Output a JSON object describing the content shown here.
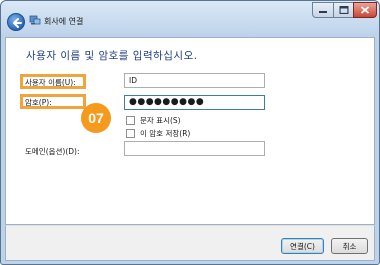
{
  "window": {
    "title": "회사에 연결",
    "controls": {
      "minimize_icon": "minimize-icon",
      "maximize_icon": "maximize-icon",
      "close_icon": "close-icon"
    },
    "back_icon": "back-arrow-icon",
    "app_icon": "network-icon"
  },
  "main": {
    "heading": "사용자 이름 및 암호를 입력하십시오.",
    "username": {
      "label": "사용자 이름(U):",
      "value": "ID"
    },
    "password": {
      "label": "암호(P):",
      "value": "●●●●●●●●●"
    },
    "show_chars": {
      "label": "문자 표시(S)",
      "checked": false
    },
    "remember": {
      "label": "이 암호 저장(R)",
      "checked": false
    },
    "domain": {
      "label": "도메인(옵션)(D):",
      "value": ""
    },
    "step_badge": "07",
    "highlight_color": "#f2a33b",
    "badge_color": "#f59a1d"
  },
  "footer": {
    "connect_label": "연결(C)",
    "cancel_label": "취소"
  }
}
